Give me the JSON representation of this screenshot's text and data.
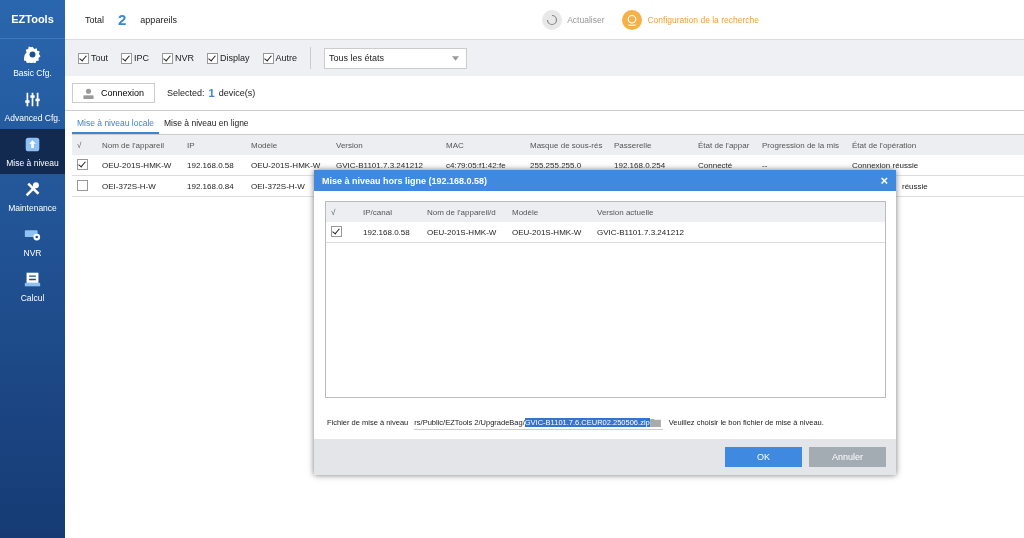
{
  "app": {
    "logo": "EZTools"
  },
  "sidebar": {
    "items": [
      {
        "label": "Basic Cfg.",
        "selected": false
      },
      {
        "label": "Advanced Cfg.",
        "selected": false
      },
      {
        "label": "Mise à niveau",
        "selected": true
      },
      {
        "label": "Maintenance",
        "selected": false
      },
      {
        "label": "NVR",
        "selected": false
      },
      {
        "label": "Calcul",
        "selected": false
      }
    ]
  },
  "summary": {
    "label": "Total",
    "count": "2",
    "unit": "appareils"
  },
  "actions": [
    {
      "label": "Actualiser",
      "active": false
    },
    {
      "label": "Configuration de la recherche",
      "active": true
    }
  ],
  "filters": [
    {
      "label": "Tout",
      "checked": true
    },
    {
      "label": "IPC",
      "checked": true
    },
    {
      "label": "NVR",
      "checked": true
    },
    {
      "label": "Display",
      "checked": true
    },
    {
      "label": "Autre",
      "checked": true
    }
  ],
  "state_filter": {
    "value": "Tous les états"
  },
  "toolbar": {
    "connect_button": "Connexion",
    "selected_label": "Selected:",
    "selected_count": "1",
    "selected_unit": "device(s)"
  },
  "tabs": [
    {
      "label": "Mise à niveau locale",
      "selected": true
    },
    {
      "label": "Mise à niveau en ligne",
      "selected": false
    }
  ],
  "table": {
    "check_header": "√",
    "columns": [
      "Nom de l'appareil",
      "IP",
      "Modèle",
      "Version",
      "MAC",
      "Masque de sous-rés",
      "Passerelle",
      "État de l'appar",
      "Progression de la mis",
      "État de l'opération"
    ],
    "rows": [
      {
        "checked": true,
        "cells": [
          "OEU-201S-HMK-W",
          "192.168.0.58",
          "OEU-201S-HMK-W",
          "GVIC-B1101.7.3.241212",
          "c4:79:05:f1:42:fe",
          "255.255.255.0",
          "192.168.0.254",
          "Connecté",
          "--",
          "Connexion réussie"
        ]
      },
      {
        "checked": false,
        "cells": [
          "OEI-372S-H-W",
          "192.168.0.84",
          "OEI-372S-H-W",
          "",
          "",
          "",
          "",
          "",
          "",
          "réussie"
        ]
      }
    ]
  },
  "dialog": {
    "title": "Mise à niveau hors ligne (192.168.0.58)",
    "close": "×",
    "check_header": "√",
    "columns": [
      "IP/canal",
      "Nom de l'appareil/d",
      "Modèle",
      "Version actuelle"
    ],
    "rows": [
      {
        "checked": true,
        "cells": [
          "192.168.0.58",
          "OEU-201S-HMK-W",
          "OEU-201S-HMK-W",
          "GVIC-B1101.7.3.241212"
        ]
      }
    ],
    "file_label": "Fichier de mise à niveau",
    "file_path": "rs/Public/EZTools 2/UpgradeBag/",
    "file_selected": "GVIC-B1101.7.6.CEUR02.250506.zip",
    "hint": "Veuillez choisir le bon fichier de mise à niveau.",
    "buttons": [
      {
        "label": "OK",
        "kind": "primary"
      },
      {
        "label": "Annuler",
        "kind": "secondary"
      }
    ]
  }
}
